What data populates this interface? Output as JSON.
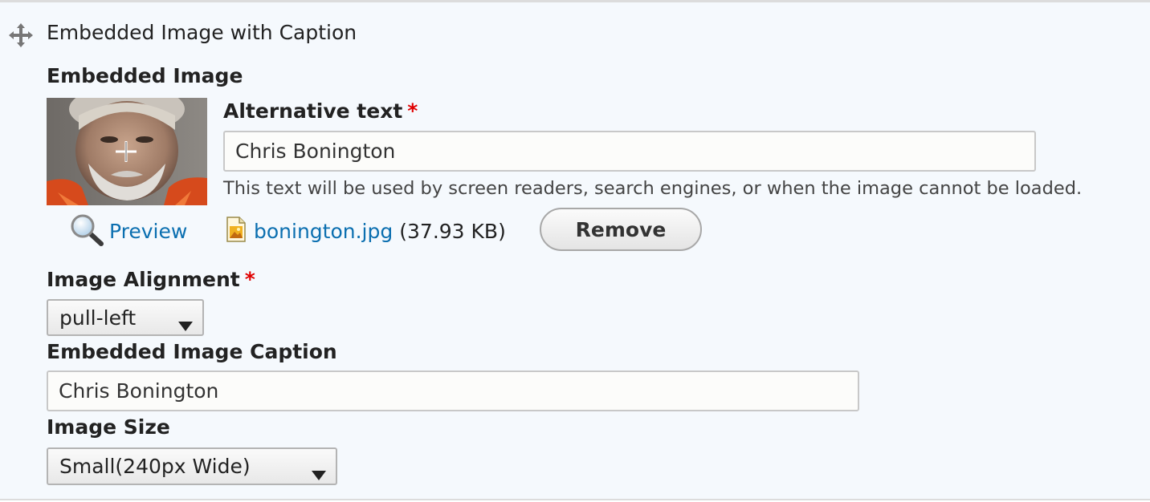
{
  "section": {
    "title": "Embedded Image with Caption",
    "drag_icon": "move-cross-icon"
  },
  "embedded_image": {
    "label": "Embedded Image",
    "alt_text": {
      "label": "Alternative text",
      "required_marker": "*",
      "value": "Chris Bonington",
      "description": "This text will be used by screen readers, search engines, or when the image cannot be loaded."
    },
    "preview_link": "Preview",
    "preview_icon": "magnifier-icon",
    "file": {
      "icon": "image-file-icon",
      "name": "bonington.jpg",
      "size": "(37.93 KB)"
    },
    "remove_button": "Remove"
  },
  "alignment": {
    "label": "Image Alignment",
    "required_marker": "*",
    "selected": "pull-left"
  },
  "caption": {
    "label": "Embedded Image Caption",
    "value": "Chris Bonington"
  },
  "size": {
    "label": "Image Size",
    "selected": "Small(240px Wide)"
  },
  "colors": {
    "background": "#f5f9fd",
    "link": "#0b6fb0",
    "required": "#e00000"
  }
}
